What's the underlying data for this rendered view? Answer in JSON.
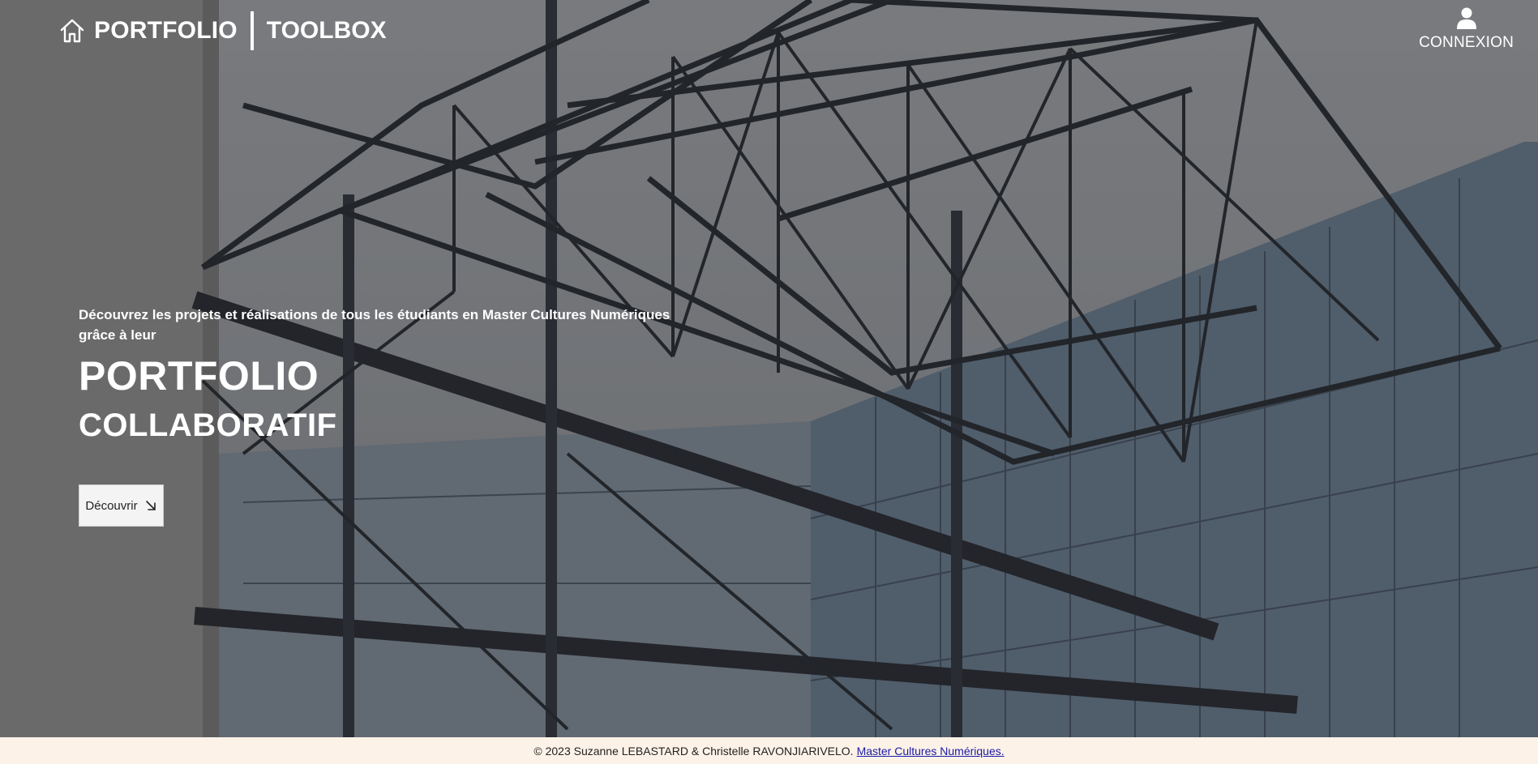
{
  "nav": {
    "brand": "PORTFOLIO",
    "toolbox": "TOOLBOX",
    "login_label": "CONNEXION"
  },
  "hero": {
    "tagline": "Découvrez les projets et réalisations de tous les étudiants en Master Cultures Numériques grâce à leur",
    "title": "PORTFOLIO",
    "subtitle": "COLLABORATIF",
    "cta_label": "Découvrir"
  },
  "footer": {
    "copyright": "© 2023 Suzanne LEBASTARD & Christelle RAVONJIARIVELO.",
    "link_label": "Master Cultures Numériques."
  },
  "icons": {
    "home": "home-icon",
    "user": "user-icon",
    "cta_arrow": "arrow-down-right-icon"
  },
  "colors": {
    "text_on_hero": "#ffffff",
    "footer_bg": "#fdf2e8",
    "footer_link": "#1a1aa6",
    "cta_bg": "#f4f4f4"
  }
}
